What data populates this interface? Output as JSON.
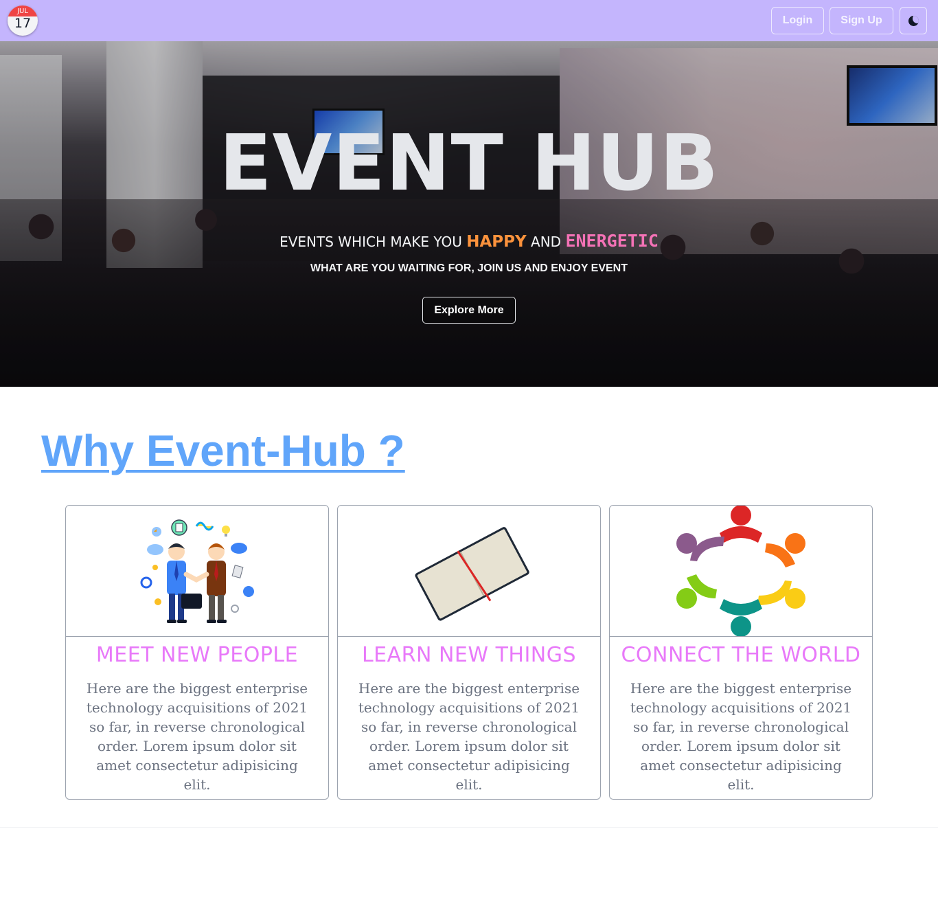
{
  "navbar": {
    "logo": {
      "month": "JUL",
      "day": "17",
      "icon": "calendar-icon"
    },
    "login_label": "Login",
    "signup_label": "Sign Up",
    "theme_icon": "moon-icon",
    "background": "#c4b5fd"
  },
  "hero": {
    "title": "EVENT HUB",
    "subtitle_pre": "EVENTS WHICH MAKE YOU",
    "subtitle_happy": "HAPPY",
    "subtitle_and": "AND",
    "subtitle_energetic": "ENERGETIC",
    "tagline": "WHAT ARE YOU WAITING FOR, JOIN US AND ENJOY EVENT",
    "button_label": "Explore More",
    "colors": {
      "happy": "#fb923c",
      "energetic": "#f472b6"
    }
  },
  "why": {
    "title": "Why Event-Hub ?",
    "color": "#60a5fa",
    "cards": [
      {
        "title": "MEET NEW PEOPLE",
        "image": "handshake-illustration",
        "text": "Here are the biggest enterprise technology acquisitions of 2021 so far, in reverse chronological order. Lorem ipsum dolor sit amet consectetur adipisicing elit."
      },
      {
        "title": "LEARN NEW THINGS",
        "image": "notebook-illustration",
        "text": "Here are the biggest enterprise technology acquisitions of 2021 so far, in reverse chronological order. Lorem ipsum dolor sit amet consectetur adipisicing elit."
      },
      {
        "title": "CONNECT THE WORLD",
        "image": "people-circle-illustration",
        "text": "Here are the biggest enterprise technology acquisitions of 2021 so far, in reverse chronological order. Lorem ipsum dolor sit amet consectetur adipisicing elit."
      }
    ]
  }
}
